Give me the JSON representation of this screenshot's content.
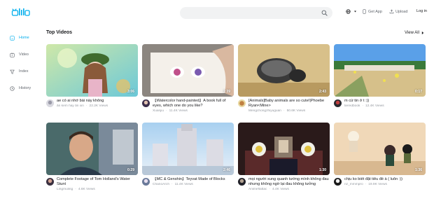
{
  "header": {
    "logo_text": "bilibili",
    "search_placeholder": "",
    "lang_label": "",
    "get_app_label": "Get App",
    "upload_label": "Upload",
    "login_label": "Log in"
  },
  "sidebar": {
    "items": [
      {
        "label": "Home",
        "icon": "home-icon",
        "active": true
      },
      {
        "label": "Video",
        "icon": "video-icon",
        "active": false
      },
      {
        "label": "Index",
        "icon": "filter-icon",
        "active": false
      },
      {
        "label": "History",
        "icon": "history-icon",
        "active": false
      }
    ]
  },
  "main": {
    "section_title": "Top Videos",
    "view_all_label": "View All"
  },
  "videos": [
    {
      "title": "ae có ai nhớ bài này không",
      "channel": "ăn kem hay ăn xin",
      "views": "22.2K Views",
      "duration": "3:06"
    },
    {
      "title": "【Watercolor hand-painted】A book full of eyes, which one do you like?",
      "channel": "Xuanjiu",
      "views": "11.4K Views",
      "duration": "1:39"
    },
    {
      "title": "[Animals]Baby animals are so cute!|Phoebe Ryan<Mine>",
      "channel": "Mengchongzhiyuguan",
      "views": "50.6K Views",
      "duration": "2:43"
    },
    {
      "title": "m cứ tin ở t :))",
      "channel": "tieredbook",
      "views": "12.4K Views",
      "duration": "0:17"
    },
    {
      "title": "Complete Footage of Tom Holland's Water Stunt",
      "channel": "Lingmuling",
      "views": "4.6K Views",
      "duration": "0:29"
    },
    {
      "title": "【MC & Genshin】Teyvat Made of Blocks",
      "channel": "ChanoArch",
      "views": "11.4K Views",
      "duration": "2:46"
    },
    {
      "title": "mọi người xung quanh tưởng mình không đau nhưng không ngờ lại đau không tưởng",
      "channel": "Animeflattac",
      "views": "4.4K Views",
      "duration": "1:30"
    },
    {
      "title": "chịu ko biết đặt tiêu đề à ( luôn :))",
      "channel": "nz_mmmpro",
      "views": "19.9K Views",
      "duration": "1:36"
    }
  ],
  "colors": {
    "brand": "#00aeec",
    "text": "#18191c",
    "muted": "#9499a0",
    "search_bg": "#f1f2f3"
  }
}
